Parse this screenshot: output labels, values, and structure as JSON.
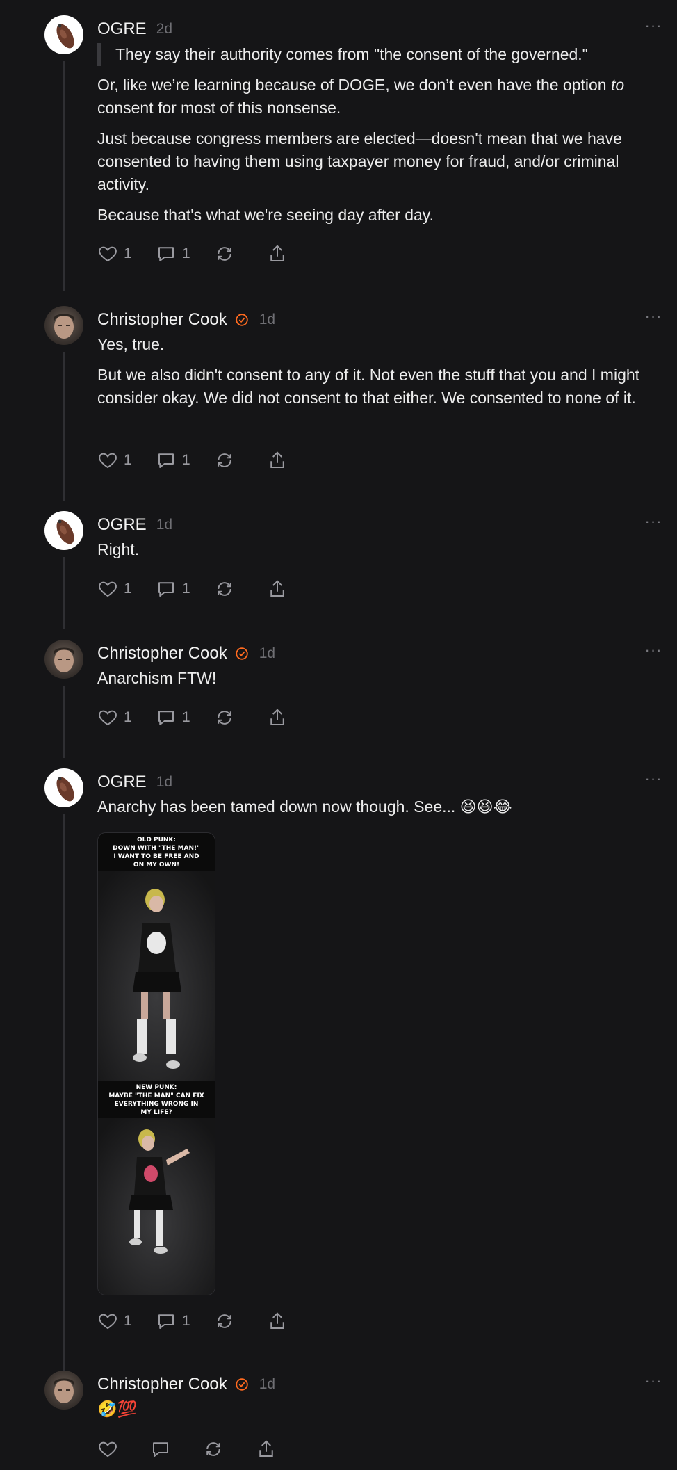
{
  "thread": {
    "posts": [
      {
        "author": "OGRE",
        "time": "2d",
        "quote": "They say their authority comes from \"the consent of the governed.\"",
        "paragraphs": [
          "Or, like we're learning because of DOGE, we don't even have the option to consent for most of this nonsense.",
          "Just because congress members are elected—doesn't mean that we have consented to having them using taxpayer money for fraud, and/or criminal activity.",
          "Because that's what we're seeing day after day."
        ],
        "likes": "1",
        "replies": "1"
      },
      {
        "author": "Christopher Cook",
        "time": "1d",
        "paragraphs": [
          "Yes, true.",
          "But we also didn't consent to any of it. Not even the stuff that you and I might consider okay. We did not consent to that either. We consented to none of it."
        ],
        "likes": "1",
        "replies": "1"
      },
      {
        "author": "OGRE",
        "time": "1d",
        "paragraphs": [
          "Right."
        ],
        "likes": "1",
        "replies": "1"
      },
      {
        "author": "Christopher Cook",
        "time": "1d",
        "paragraphs": [
          "Anarchism FTW!"
        ],
        "likes": "1",
        "replies": "1"
      },
      {
        "author": "OGRE",
        "time": "1d",
        "paragraphs": [
          "Anarchy has been tamed down now though. See... 😆😆😂"
        ],
        "image_text": {
          "top": "OLD PUNK:\nDOWN WITH \"THE MAN!\"\nI WANT TO BE FREE AND\nON MY OWN!",
          "bottom": "NEW PUNK:\nMAYBE \"THE MAN\" CAN FIX\nEVERYTHING WRONG IN\nMY LIFE?"
        },
        "likes": "1",
        "replies": "1"
      },
      {
        "author": "Christopher Cook",
        "time": "1d",
        "paragraphs": [
          "🤣💯"
        ]
      }
    ]
  },
  "colors": {
    "background": "#151517",
    "verified": "#ff6a1f",
    "muted": "#6f6f74"
  }
}
